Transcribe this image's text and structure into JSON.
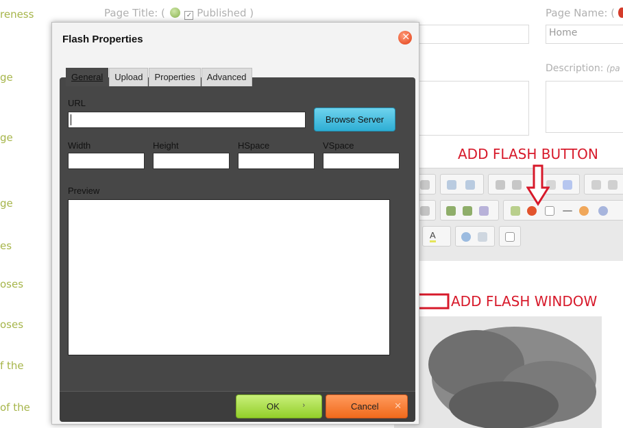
{
  "background": {
    "sidebar": [
      "reness",
      "ge",
      "ge",
      "ge",
      "es",
      "oses",
      "oses",
      "f the",
      "of the"
    ],
    "page_title_label": "Page Title: (",
    "published_label": "Published )",
    "page_name_label": "Page Name: (",
    "page_name_value": "Home",
    "description_label": "Description:",
    "description_hint": "(pa"
  },
  "annotations": {
    "add_flash_button": "ADD FLASH BUTTON",
    "add_flash_window": "ADD FLASH WINDOW"
  },
  "dialog": {
    "title": "Flash Properties",
    "tabs": [
      "General",
      "Upload",
      "Properties",
      "Advanced"
    ],
    "url_label": "URL",
    "url_value": "",
    "browse_label": "Browse Server",
    "width_label": "Width",
    "height_label": "Height",
    "hspace_label": "HSpace",
    "vspace_label": "VSpace",
    "preview_label": "Preview",
    "ok_label": "OK",
    "cancel_label": "Cancel"
  },
  "colors": {
    "annotation": "#d7192a",
    "ok_button": "#93cf2a",
    "cancel_button": "#f06a1c",
    "browse_button": "#2eaed4",
    "panel": "#474747"
  }
}
